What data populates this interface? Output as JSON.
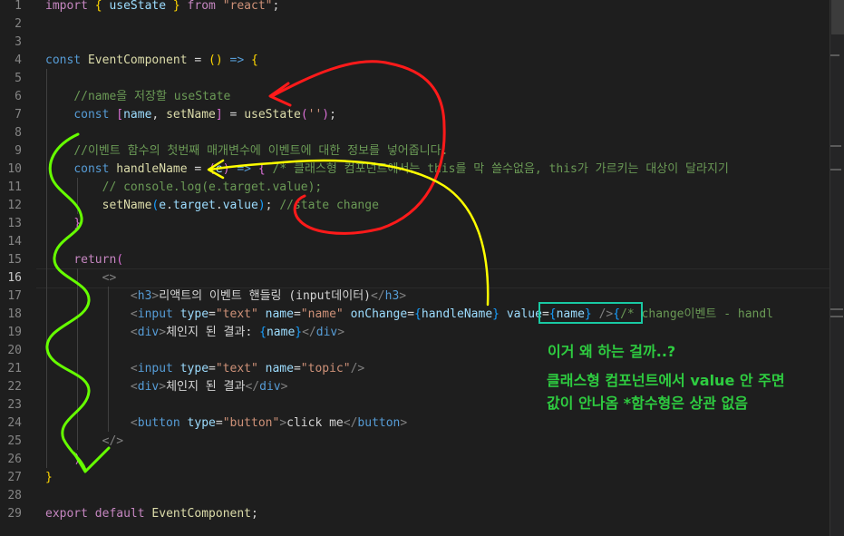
{
  "editor": {
    "lines": [
      {
        "n": "1",
        "spans": [
          {
            "c": "ctl",
            "t": "import "
          },
          {
            "c": "br1",
            "t": "{ "
          },
          {
            "c": "var",
            "t": "useState"
          },
          {
            "c": "br1",
            "t": " }"
          },
          {
            "c": "ctl",
            "t": " from "
          },
          {
            "c": "str",
            "t": "\"react\""
          },
          {
            "c": "txt",
            "t": ";"
          }
        ]
      },
      {
        "n": "2",
        "spans": []
      },
      {
        "n": "3",
        "spans": []
      },
      {
        "n": "4",
        "spans": [
          {
            "c": "kw",
            "t": "const "
          },
          {
            "c": "fn",
            "t": "EventComponent"
          },
          {
            "c": "txt",
            "t": " = "
          },
          {
            "c": "br1",
            "t": "()"
          },
          {
            "c": "kw",
            "t": " => "
          },
          {
            "c": "br1",
            "t": "{"
          }
        ]
      },
      {
        "n": "5",
        "spans": []
      },
      {
        "n": "6",
        "spans": [
          {
            "c": "txt",
            "t": "    "
          },
          {
            "c": "cmt",
            "t": "//name을 저장할 useState"
          }
        ]
      },
      {
        "n": "7",
        "spans": [
          {
            "c": "txt",
            "t": "    "
          },
          {
            "c": "kw",
            "t": "const "
          },
          {
            "c": "br2",
            "t": "["
          },
          {
            "c": "var",
            "t": "name"
          },
          {
            "c": "txt",
            "t": ", "
          },
          {
            "c": "fn",
            "t": "setName"
          },
          {
            "c": "br2",
            "t": "]"
          },
          {
            "c": "txt",
            "t": " = "
          },
          {
            "c": "fn",
            "t": "useState"
          },
          {
            "c": "br2",
            "t": "("
          },
          {
            "c": "str",
            "t": "''"
          },
          {
            "c": "br2",
            "t": ")"
          },
          {
            "c": "txt",
            "t": ";"
          }
        ]
      },
      {
        "n": "8",
        "spans": []
      },
      {
        "n": "9",
        "spans": [
          {
            "c": "txt",
            "t": "    "
          },
          {
            "c": "cmt",
            "t": "//이벤트 함수의 첫번째 매개변수에 이벤트에 대한 정보를 넣어줍니다."
          }
        ]
      },
      {
        "n": "10",
        "spans": [
          {
            "c": "txt",
            "t": "    "
          },
          {
            "c": "kw",
            "t": "const "
          },
          {
            "c": "fn",
            "t": "handleName"
          },
          {
            "c": "txt",
            "t": " = "
          },
          {
            "c": "br2",
            "t": "("
          },
          {
            "c": "var",
            "t": "e"
          },
          {
            "c": "br2",
            "t": ")"
          },
          {
            "c": "kw",
            "t": " => "
          },
          {
            "c": "br2",
            "t": "{"
          },
          {
            "c": "txt",
            "t": " "
          },
          {
            "c": "cmt",
            "t": "/* 클래스형 컴포넌트에서는 this를 막 쓸수없음, this가 가르키는 대상이 달라지기"
          }
        ]
      },
      {
        "n": "11",
        "spans": [
          {
            "c": "txt",
            "t": "        "
          },
          {
            "c": "cmt",
            "t": "// console.log(e.target.value);"
          }
        ]
      },
      {
        "n": "12",
        "spans": [
          {
            "c": "txt",
            "t": "        "
          },
          {
            "c": "fn",
            "t": "setName"
          },
          {
            "c": "br3",
            "t": "("
          },
          {
            "c": "var",
            "t": "e"
          },
          {
            "c": "txt",
            "t": "."
          },
          {
            "c": "var",
            "t": "target"
          },
          {
            "c": "txt",
            "t": "."
          },
          {
            "c": "var",
            "t": "value"
          },
          {
            "c": "br3",
            "t": ")"
          },
          {
            "c": "txt",
            "t": "; "
          },
          {
            "c": "cmt",
            "t": "//state change"
          }
        ]
      },
      {
        "n": "13",
        "spans": [
          {
            "c": "txt",
            "t": "    "
          },
          {
            "c": "br2",
            "t": "}"
          }
        ]
      },
      {
        "n": "14",
        "spans": []
      },
      {
        "n": "15",
        "spans": [
          {
            "c": "txt",
            "t": "    "
          },
          {
            "c": "ctl",
            "t": "return"
          },
          {
            "c": "br2",
            "t": "("
          }
        ]
      },
      {
        "n": "16",
        "spans": [
          {
            "c": "txt",
            "t": "        "
          },
          {
            "c": "punct",
            "t": "<>"
          }
        ]
      },
      {
        "n": "17",
        "spans": [
          {
            "c": "txt",
            "t": "            "
          },
          {
            "c": "punct",
            "t": "<"
          },
          {
            "c": "tag",
            "t": "h3"
          },
          {
            "c": "punct",
            "t": ">"
          },
          {
            "c": "txt",
            "t": "리액트의 이벤트 핸들링 (input데이터)"
          },
          {
            "c": "punct",
            "t": "</"
          },
          {
            "c": "tag",
            "t": "h3"
          },
          {
            "c": "punct",
            "t": ">"
          }
        ]
      },
      {
        "n": "18",
        "spans": [
          {
            "c": "txt",
            "t": "            "
          },
          {
            "c": "punct",
            "t": "<"
          },
          {
            "c": "tag",
            "t": "input"
          },
          {
            "c": "txt",
            "t": " "
          },
          {
            "c": "var",
            "t": "type"
          },
          {
            "c": "txt",
            "t": "="
          },
          {
            "c": "str",
            "t": "\"text\""
          },
          {
            "c": "txt",
            "t": " "
          },
          {
            "c": "var",
            "t": "name"
          },
          {
            "c": "txt",
            "t": "="
          },
          {
            "c": "str",
            "t": "\"name\""
          },
          {
            "c": "txt",
            "t": " "
          },
          {
            "c": "var",
            "t": "onChange"
          },
          {
            "c": "txt",
            "t": "="
          },
          {
            "c": "br3",
            "t": "{"
          },
          {
            "c": "var",
            "t": "handleName"
          },
          {
            "c": "br3",
            "t": "}"
          },
          {
            "c": "txt",
            "t": " "
          },
          {
            "c": "var",
            "t": "value"
          },
          {
            "c": "txt",
            "t": "="
          },
          {
            "c": "br3",
            "t": "{"
          },
          {
            "c": "var",
            "t": "name"
          },
          {
            "c": "br3",
            "t": "}"
          },
          {
            "c": "txt",
            "t": " "
          },
          {
            "c": "punct",
            "t": "/>"
          },
          {
            "c": "br3",
            "t": "{"
          },
          {
            "c": "cmt",
            "t": "/* change이벤트 - handl"
          }
        ]
      },
      {
        "n": "19",
        "spans": [
          {
            "c": "txt",
            "t": "            "
          },
          {
            "c": "punct",
            "t": "<"
          },
          {
            "c": "tag",
            "t": "div"
          },
          {
            "c": "punct",
            "t": ">"
          },
          {
            "c": "txt",
            "t": "체인지 된 결과: "
          },
          {
            "c": "br3",
            "t": "{"
          },
          {
            "c": "var",
            "t": "name"
          },
          {
            "c": "br3",
            "t": "}"
          },
          {
            "c": "punct",
            "t": "</"
          },
          {
            "c": "tag",
            "t": "div"
          },
          {
            "c": "punct",
            "t": ">"
          }
        ]
      },
      {
        "n": "20",
        "spans": []
      },
      {
        "n": "21",
        "spans": [
          {
            "c": "txt",
            "t": "            "
          },
          {
            "c": "punct",
            "t": "<"
          },
          {
            "c": "tag",
            "t": "input"
          },
          {
            "c": "txt",
            "t": " "
          },
          {
            "c": "var",
            "t": "type"
          },
          {
            "c": "txt",
            "t": "="
          },
          {
            "c": "str",
            "t": "\"text\""
          },
          {
            "c": "txt",
            "t": " "
          },
          {
            "c": "var",
            "t": "name"
          },
          {
            "c": "txt",
            "t": "="
          },
          {
            "c": "str",
            "t": "\"topic\""
          },
          {
            "c": "punct",
            "t": "/>"
          }
        ]
      },
      {
        "n": "22",
        "spans": [
          {
            "c": "txt",
            "t": "            "
          },
          {
            "c": "punct",
            "t": "<"
          },
          {
            "c": "tag",
            "t": "div"
          },
          {
            "c": "punct",
            "t": ">"
          },
          {
            "c": "txt",
            "t": "체인지 된 결과"
          },
          {
            "c": "punct",
            "t": "</"
          },
          {
            "c": "tag",
            "t": "div"
          },
          {
            "c": "punct",
            "t": ">"
          }
        ]
      },
      {
        "n": "23",
        "spans": []
      },
      {
        "n": "24",
        "spans": [
          {
            "c": "txt",
            "t": "            "
          },
          {
            "c": "punct",
            "t": "<"
          },
          {
            "c": "tag",
            "t": "button"
          },
          {
            "c": "txt",
            "t": " "
          },
          {
            "c": "var",
            "t": "type"
          },
          {
            "c": "txt",
            "t": "="
          },
          {
            "c": "str",
            "t": "\"button\""
          },
          {
            "c": "punct",
            "t": ">"
          },
          {
            "c": "txt",
            "t": "click me"
          },
          {
            "c": "punct",
            "t": "</"
          },
          {
            "c": "tag",
            "t": "button"
          },
          {
            "c": "punct",
            "t": ">"
          }
        ]
      },
      {
        "n": "25",
        "spans": [
          {
            "c": "txt",
            "t": "        "
          },
          {
            "c": "punct",
            "t": "</>"
          }
        ]
      },
      {
        "n": "26",
        "spans": [
          {
            "c": "txt",
            "t": "    "
          },
          {
            "c": "br2",
            "t": ")"
          }
        ]
      },
      {
        "n": "27",
        "spans": [
          {
            "c": "br1",
            "t": "}"
          }
        ]
      },
      {
        "n": "28",
        "spans": []
      },
      {
        "n": "29",
        "spans": [
          {
            "c": "ctl",
            "t": "export "
          },
          {
            "c": "ctl",
            "t": "default "
          },
          {
            "c": "fn",
            "t": "EventComponent"
          },
          {
            "c": "txt",
            "t": ";"
          }
        ]
      }
    ],
    "active_line": "16"
  },
  "annotations": {
    "question": "이거 왜 하는 걸까..?",
    "answer_line1": "클래스형 컴포넌트에서 value 안 주면",
    "answer_line2": "값이 안나옴 *함수형은 상관 없음"
  },
  "colors": {
    "highlight_box": "#19c9a3",
    "note_text": "#2ecc40",
    "ink_red": "#ff1a1a",
    "ink_yellow": "#ffff00",
    "ink_green": "#66ff00"
  }
}
